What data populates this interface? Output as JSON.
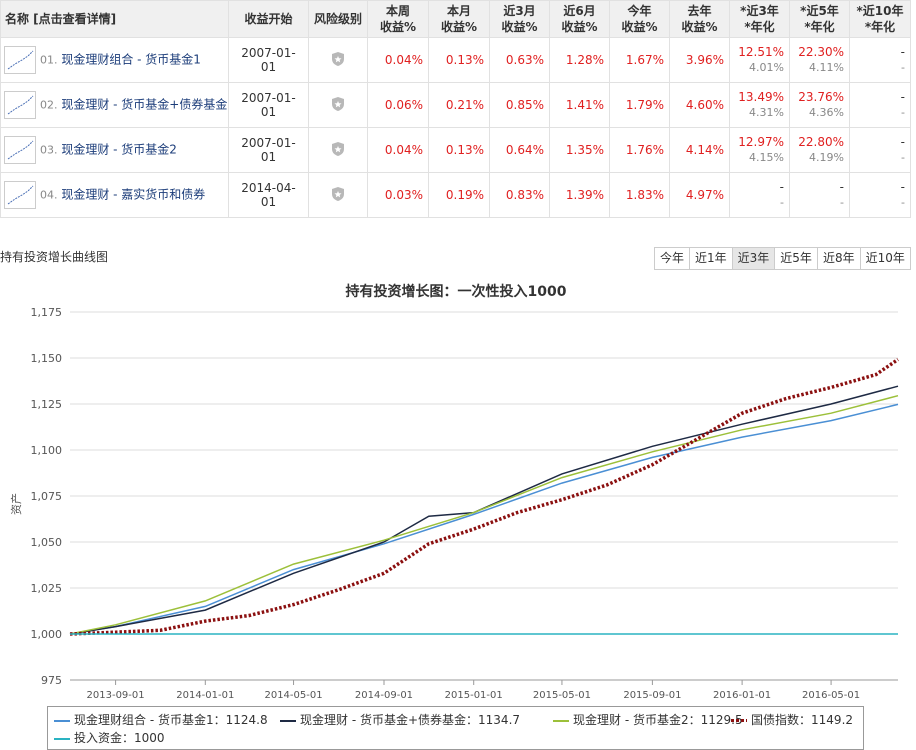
{
  "table": {
    "headers": {
      "name": "名称 [点击查看详情]",
      "start": "收益开始",
      "risk": "风险级别",
      "week_a": "本周",
      "week_b": "收益%",
      "month_a": "本月",
      "month_b": "收益%",
      "m3_a": "近3月",
      "m3_b": "收益%",
      "m6_a": "近6月",
      "m6_b": "收益%",
      "ytd_a": "今年",
      "ytd_b": "收益%",
      "ly_a": "去年",
      "ly_b": "收益%",
      "y3_a": "*近3年",
      "y3_b": "*年化",
      "y5_a": "*近5年",
      "y5_b": "*年化",
      "y10_a": "*近10年",
      "y10_b": "*年化"
    },
    "rows": [
      {
        "idx": "01.",
        "name": "现金理财组合 - 货币基金1",
        "start": "2007-01-01",
        "week": "0.04%",
        "month": "0.13%",
        "m3": "0.63%",
        "m6": "1.28%",
        "ytd": "1.67%",
        "ly": "3.96%",
        "y3a": "12.51%",
        "y3b": "4.01%",
        "y5a": "22.30%",
        "y5b": "4.11%",
        "y10a": "-",
        "y10b": "-"
      },
      {
        "idx": "02.",
        "name": "现金理财 - 货币基金+债券基金",
        "start": "2007-01-01",
        "week": "0.06%",
        "month": "0.21%",
        "m3": "0.85%",
        "m6": "1.41%",
        "ytd": "1.79%",
        "ly": "4.60%",
        "y3a": "13.49%",
        "y3b": "4.31%",
        "y5a": "23.76%",
        "y5b": "4.36%",
        "y10a": "-",
        "y10b": "-"
      },
      {
        "idx": "03.",
        "name": "现金理财 - 货币基金2",
        "start": "2007-01-01",
        "week": "0.04%",
        "month": "0.13%",
        "m3": "0.64%",
        "m6": "1.35%",
        "ytd": "1.76%",
        "ly": "4.14%",
        "y3a": "12.97%",
        "y3b": "4.15%",
        "y5a": "22.80%",
        "y5b": "4.19%",
        "y10a": "-",
        "y10b": "-"
      },
      {
        "idx": "04.",
        "name": "现金理财 - 嘉实货币和债券",
        "start": "2014-04-01",
        "week": "0.03%",
        "month": "0.19%",
        "m3": "0.83%",
        "m6": "1.39%",
        "ytd": "1.83%",
        "ly": "4.97%",
        "y3a": "-",
        "y3b": "-",
        "y5a": "-",
        "y5b": "-",
        "y10a": "-",
        "y10b": "-"
      }
    ]
  },
  "section_title": "持有投资增长曲线图",
  "range_tabs": [
    "今年",
    "近1年",
    "近3年",
    "近5年",
    "近8年",
    "近10年"
  ],
  "active_range": "近3年",
  "chart_data": {
    "type": "line",
    "title": "持有投资增长图：一次性投入1000",
    "ylabel": "资产",
    "ylim": [
      975,
      1175
    ],
    "yticks": [
      975,
      1000,
      1025,
      1050,
      1075,
      1100,
      1125,
      1150,
      1175
    ],
    "ytick_labels": [
      "975",
      "1,000",
      "1,025",
      "1,050",
      "1,075",
      "1,100",
      "1,125",
      "1,150",
      "1,175"
    ],
    "xlim": [
      "2013-07-01",
      "2016-07-31"
    ],
    "xtick_labels": [
      "2013-09-01",
      "2014-01-01",
      "2014-05-01",
      "2014-09-01",
      "2015-01-01",
      "2015-05-01",
      "2015-09-01",
      "2016-01-01",
      "2016-05-01"
    ],
    "grid": true,
    "legend_position": "bottom",
    "series": [
      {
        "name": "现金理财组合 - 货币基金1",
        "final": "1124.8",
        "color": "#4a8fd4",
        "style": "solid",
        "points": [
          [
            "2013-07-01",
            1000
          ],
          [
            "2013-09-01",
            1004
          ],
          [
            "2014-01-01",
            1015
          ],
          [
            "2014-05-01",
            1035
          ],
          [
            "2014-09-01",
            1049
          ],
          [
            "2015-01-01",
            1065
          ],
          [
            "2015-05-01",
            1082
          ],
          [
            "2015-09-01",
            1096
          ],
          [
            "2016-01-01",
            1107
          ],
          [
            "2016-05-01",
            1116
          ],
          [
            "2016-07-31",
            1124.8
          ]
        ]
      },
      {
        "name": "现金理财 - 货币基金+债券基金",
        "final": "1134.7",
        "color": "#1e2a44",
        "style": "solid",
        "points": [
          [
            "2013-07-01",
            1000
          ],
          [
            "2013-09-01",
            1004
          ],
          [
            "2014-01-01",
            1013
          ],
          [
            "2014-05-01",
            1033
          ],
          [
            "2014-09-01",
            1050
          ],
          [
            "2014-11-01",
            1064
          ],
          [
            "2015-01-01",
            1066
          ],
          [
            "2015-05-01",
            1087
          ],
          [
            "2015-09-01",
            1102
          ],
          [
            "2016-01-01",
            1114
          ],
          [
            "2016-05-01",
            1125
          ],
          [
            "2016-07-31",
            1134.7
          ]
        ]
      },
      {
        "name": "现金理财 - 货币基金2",
        "final": "1129.5",
        "color": "#9cc03a",
        "style": "solid",
        "points": [
          [
            "2013-07-01",
            1000
          ],
          [
            "2013-09-01",
            1005
          ],
          [
            "2014-01-01",
            1018
          ],
          [
            "2014-05-01",
            1038
          ],
          [
            "2014-09-01",
            1051
          ],
          [
            "2015-01-01",
            1066
          ],
          [
            "2015-05-01",
            1085
          ],
          [
            "2015-09-01",
            1099
          ],
          [
            "2016-01-01",
            1111
          ],
          [
            "2016-05-01",
            1120
          ],
          [
            "2016-07-31",
            1129.5
          ]
        ]
      },
      {
        "name": "国债指数",
        "final": "1149.2",
        "color": "#8b1010",
        "style": "dotted",
        "points": [
          [
            "2013-07-01",
            1000
          ],
          [
            "2013-09-01",
            1001
          ],
          [
            "2013-11-01",
            1002
          ],
          [
            "2014-01-01",
            1007
          ],
          [
            "2014-03-01",
            1010
          ],
          [
            "2014-05-01",
            1016
          ],
          [
            "2014-07-01",
            1024
          ],
          [
            "2014-09-01",
            1033
          ],
          [
            "2014-11-01",
            1049
          ],
          [
            "2015-01-01",
            1057
          ],
          [
            "2015-03-01",
            1066
          ],
          [
            "2015-05-01",
            1073
          ],
          [
            "2015-07-01",
            1081
          ],
          [
            "2015-09-01",
            1092
          ],
          [
            "2015-11-01",
            1106
          ],
          [
            "2016-01-01",
            1120
          ],
          [
            "2016-03-01",
            1128
          ],
          [
            "2016-05-01",
            1134
          ],
          [
            "2016-07-01",
            1141
          ],
          [
            "2016-07-31",
            1149.2
          ]
        ]
      },
      {
        "name": "投入资金",
        "final": "1000",
        "color": "#2ab3c2",
        "style": "solid",
        "points": [
          [
            "2013-07-01",
            1000
          ],
          [
            "2016-07-31",
            1000
          ]
        ]
      }
    ]
  }
}
